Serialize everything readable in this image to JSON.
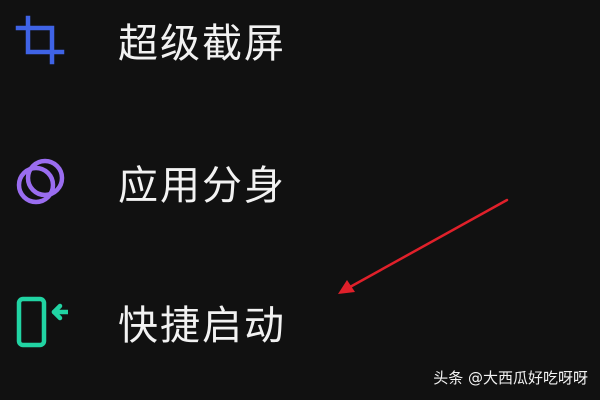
{
  "menu": {
    "items": [
      {
        "label": "超级截屏",
        "icon": "crop-icon",
        "icon_color": "#3f63e6"
      },
      {
        "label": "应用分身",
        "icon": "overlapping-circles-icon",
        "icon_color": "#9a6df0"
      },
      {
        "label": "快捷启动",
        "icon": "quick-launch-icon",
        "icon_color": "#21d4a3"
      }
    ]
  },
  "annotation": {
    "arrow_color": "#e0202a"
  },
  "watermark": {
    "text": "头条 @大西瓜好吃呀呀"
  },
  "colors": {
    "background": "#111111",
    "text": "#f2f2f2"
  }
}
